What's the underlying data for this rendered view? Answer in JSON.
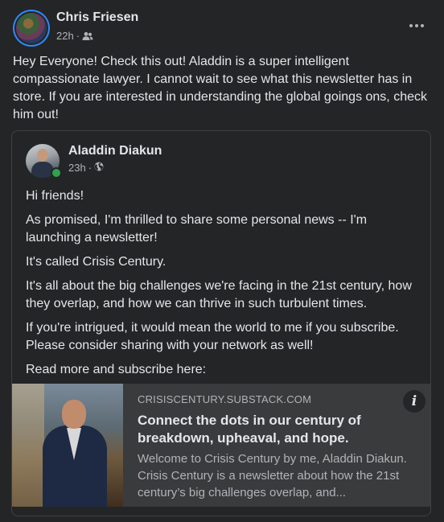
{
  "post": {
    "author": "Chris Friesen",
    "time": "22h",
    "audience_icon": "friends-icon",
    "text": "Hey Everyone! Check this out! Aladdin is a super intelligent compassionate lawyer. I cannot wait to see what this newsletter has in store. If you are interested in understanding the global goings ons, check him out!"
  },
  "shared_post": {
    "author": "Aladdin Diakun",
    "time": "23h",
    "audience_icon": "globe-icon",
    "paragraphs": [
      "Hi friends!",
      "As promised, I'm thrilled to share some personal news -- I'm launching a newsletter!",
      "It's called Crisis Century.",
      "It's all about the big challenges we're facing in the 21st century, how they overlap, and how we can thrive in such turbulent times.",
      "If you're intrigued, it would mean the world to me if you subscribe. Please consider sharing with your network as well!",
      "Read more and subscribe here:"
    ]
  },
  "link_preview": {
    "domain": "CRISISCENTURY.SUBSTACK.COM",
    "title": "Connect the dots in our century of breakdown, upheaval, and hope.",
    "description": "Welcome to Crisis Century by me, Aladdin Diakun. Crisis Century is a newsletter about how the 21st century’s big challenges overlap, and...",
    "info_label": "i"
  },
  "colors": {
    "background": "#242526",
    "card": "#3a3b3c",
    "text_primary": "#e4e6eb",
    "text_secondary": "#b0b3b8",
    "online": "#31a24c",
    "story_ring": "#2d88ff"
  }
}
